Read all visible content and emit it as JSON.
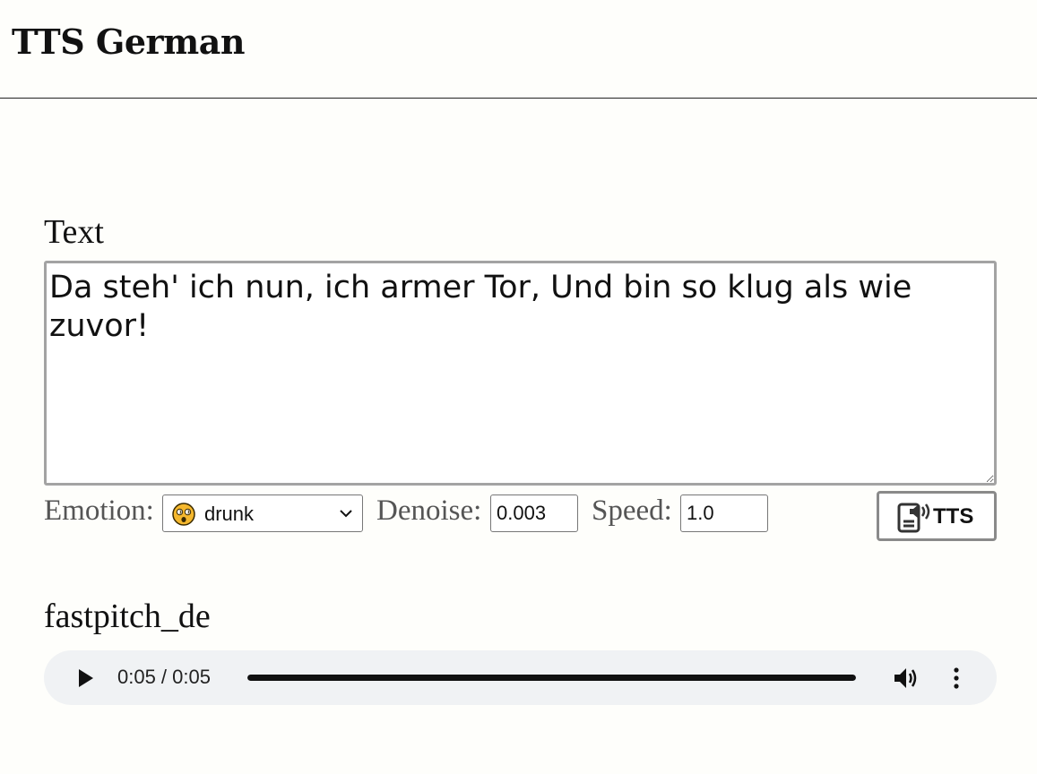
{
  "app": {
    "title": "TTS German"
  },
  "form": {
    "text_label": "Text",
    "text_value": "Da steh' ich nun, ich armer Tor, Und bin so klug als wie zuvor!",
    "emotion_label": "Emotion:",
    "emotion_value": "drunk",
    "emotion_icon": "dizzy-face-emoji",
    "denoise_label": "Denoise:",
    "denoise_value": "0.003",
    "speed_label": "Speed:",
    "speed_value": "1.0",
    "tts_button_label": "TTS",
    "tts_button_icon": "speaker-document-icon"
  },
  "result": {
    "model_label": "fastpitch_de",
    "audio": {
      "time": "0:05 / 0:05",
      "progress_fraction": 1.0
    }
  },
  "colors": {
    "background": "#fefefb",
    "player_background": "#f0f2f4",
    "emoji_face": "#f5b82e",
    "border": "#a3a3a3"
  }
}
